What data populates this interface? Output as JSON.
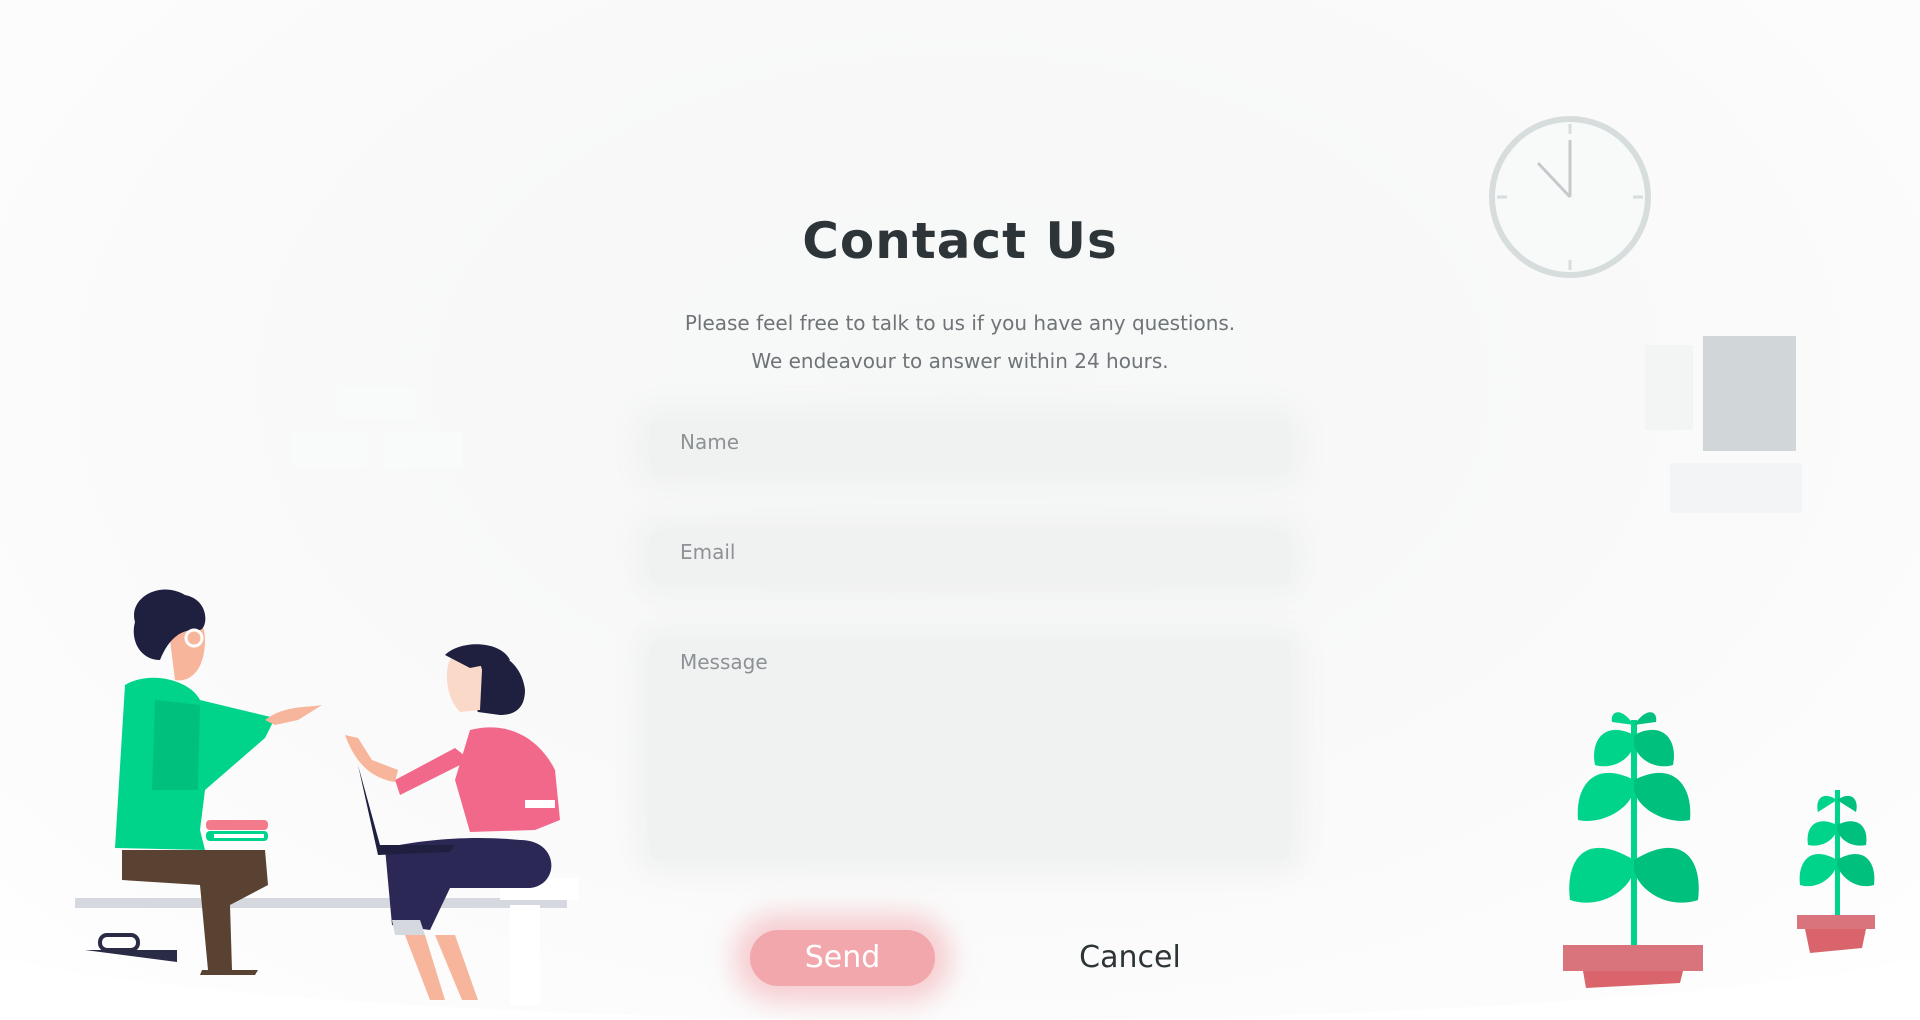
{
  "page": {
    "title": "Contact Us",
    "subtitle_line1": "Please feel free to talk to us if you have any questions.",
    "subtitle_line2": "We endeavour to answer within 24 hours."
  },
  "form": {
    "name_placeholder": "Name",
    "email_placeholder": "Email",
    "message_placeholder": "Message",
    "send_label": "Send",
    "cancel_label": "Cancel"
  },
  "colors": {
    "accent": "#f2a7ad",
    "heading": "#2e3538",
    "body_text": "#6e7477",
    "field_bg": "#f0f1f1",
    "plant_green": "#00d48b",
    "pot_red": "#d9646b"
  },
  "illustrations": {
    "clock": "wall-clock-icon",
    "people": "two-people-talking-illustration",
    "plants": "potted-plant-icon",
    "frames": "wall-picture-frames"
  }
}
